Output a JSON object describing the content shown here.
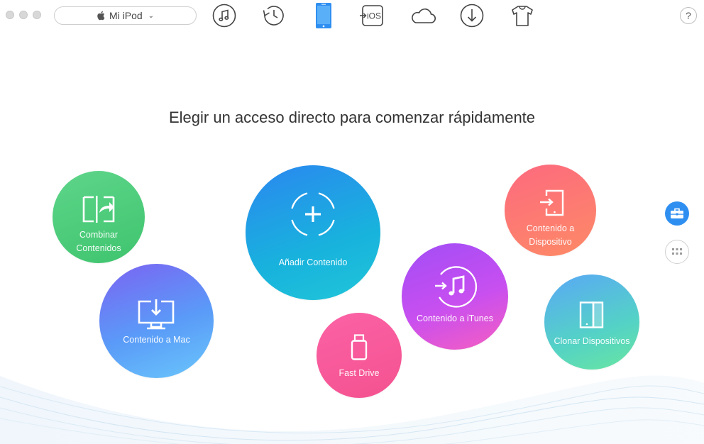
{
  "toolbar": {
    "device_name": "Mi iPod",
    "tools": [
      {
        "icon": "itunes-music-icon"
      },
      {
        "icon": "history-clock-icon"
      },
      {
        "icon": "device-phone-icon",
        "active": true
      },
      {
        "icon": "to-ios-icon",
        "label": "iOS"
      },
      {
        "icon": "icloud-icon"
      },
      {
        "icon": "download-icon"
      },
      {
        "icon": "tshirt-icon"
      }
    ],
    "help_label": "?",
    "active_color": "#2f8ff1"
  },
  "main": {
    "title": "Elegir un acceso directo para comenzar rápidamente",
    "shortcuts": {
      "combinar": {
        "label": "Combinar Contenidos",
        "line1": "Combinar",
        "line2": "Contenidos",
        "icon": "merge-folder-icon"
      },
      "mac": {
        "label": "Contenido a Mac",
        "icon": "computer-download-icon"
      },
      "anadir": {
        "label": "Añadir Contenido",
        "icon": "add-circle-icon"
      },
      "fast": {
        "label": "Fast Drive",
        "icon": "usb-drive-icon"
      },
      "itunes": {
        "label": "Contenido a iTunes",
        "icon": "itunes-transfer-icon"
      },
      "dispositivo": {
        "label": "Contenido a Dispositivo",
        "line1": "Contenido a",
        "line2": "Dispositivo",
        "icon": "phone-transfer-icon"
      },
      "clonar": {
        "label": "Clonar Dispositivos",
        "icon": "clone-device-icon"
      }
    }
  },
  "side": {
    "toolkit_icon": "toolbox-icon",
    "grid_icon": "grid-icon"
  }
}
